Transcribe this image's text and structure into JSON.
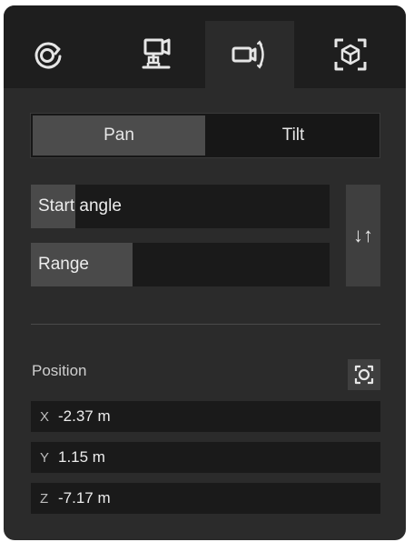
{
  "tabs": [
    {
      "icon": "rotate-camera-icon",
      "active": false
    },
    {
      "icon": "camera-mount-icon",
      "active": false
    },
    {
      "icon": "camera-pan-icon",
      "active": true
    },
    {
      "icon": "cube-focus-icon",
      "active": false
    }
  ],
  "mode_toggle": {
    "options": [
      "Pan",
      "Tilt"
    ],
    "selected": "Pan"
  },
  "sliders": {
    "start_angle": {
      "label": "Start angle",
      "fill_fraction": 0.15
    },
    "range": {
      "label": "Range",
      "fill_fraction": 0.34
    }
  },
  "swap_button": {
    "icon": "swap-arrows-icon",
    "glyph": "↓↑"
  },
  "position": {
    "title": "Position",
    "focus_icon": "focus-target-icon",
    "coords": [
      {
        "axis": "X",
        "value": "-2.37 m"
      },
      {
        "axis": "Y",
        "value": "1.15 m"
      },
      {
        "axis": "Z",
        "value": "-7.17 m"
      }
    ]
  },
  "colors": {
    "panel": "#2b2b2b",
    "tabbar": "#1e1e1e",
    "field": "#1a1a1a",
    "fill": "#4a4a4a",
    "text": "#ececec"
  }
}
